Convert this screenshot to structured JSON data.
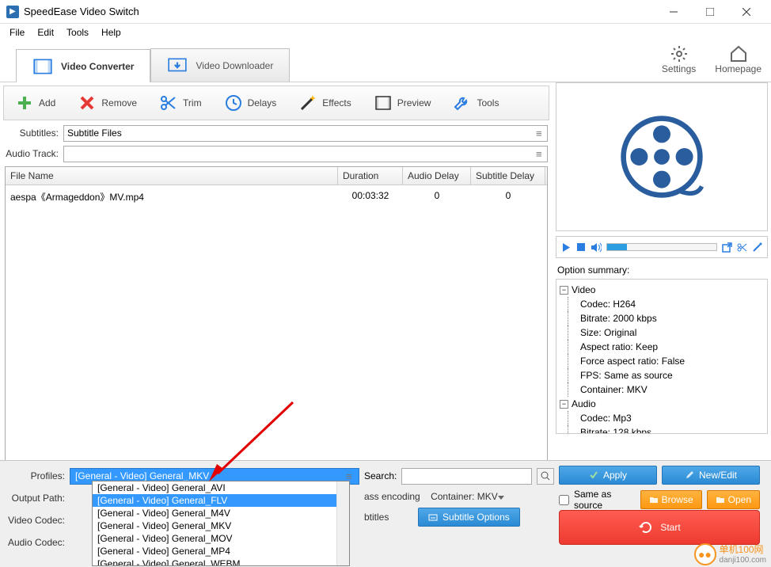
{
  "window": {
    "title": "SpeedEase Video Switch"
  },
  "menu": [
    "File",
    "Edit",
    "Tools",
    "Help"
  ],
  "tabs": [
    {
      "label": "Video Converter",
      "active": true
    },
    {
      "label": "Video Downloader",
      "active": false
    }
  ],
  "header_icons": {
    "settings": "Settings",
    "homepage": "Homepage"
  },
  "toolbar": {
    "add": "Add",
    "remove": "Remove",
    "trim": "Trim",
    "delays": "Delays",
    "effects": "Effects",
    "preview": "Preview",
    "tools": "Tools"
  },
  "fields": {
    "subtitles_label": "Subtitles:",
    "subtitles_value": "Subtitle Files",
    "audiotrack_label": "Audio Track:",
    "audiotrack_value": ""
  },
  "table": {
    "headers": [
      "File Name",
      "Duration",
      "Audio Delay",
      "Subtitle Delay"
    ],
    "rows": [
      {
        "filename": "aespa《Armageddon》MV.mp4",
        "duration": "00:03:32",
        "audio_delay": "0",
        "subtitle_delay": "0"
      }
    ]
  },
  "option_summary": {
    "title": "Option summary:",
    "video": {
      "label": "Video",
      "codec": "Codec: H264",
      "bitrate": "Bitrate: 2000 kbps",
      "size": "Size:  Original",
      "aspect": "Aspect ratio: Keep",
      "force_aspect": "Force aspect ratio: False",
      "fps": "FPS: Same as source",
      "container": "Container: MKV"
    },
    "audio": {
      "label": "Audio",
      "codec": "Codec: Mp3",
      "bitrate": "Bitrate: 128 kbps"
    }
  },
  "bottom": {
    "profiles_label": "Profiles:",
    "profiles_value": "[General - Video] General_MKV",
    "outputpath_label": "Output Path:",
    "videocodec_label": "Video Codec:",
    "audiocodec_label": "Audio Codec:",
    "search_label": "Search:",
    "twopass_text": "ass encoding",
    "subtitles_text": "btitles",
    "container_label": "Container:",
    "container_value": "MKV",
    "subtitle_options": "Subtitle Options",
    "apply": "Apply",
    "newedit": "New/Edit",
    "same_as_source": "Same as source",
    "browse": "Browse",
    "open": "Open",
    "start": "Start"
  },
  "dropdown": {
    "options": [
      "[General - Video] General_AVI",
      "[General - Video] General_FLV",
      "[General - Video] General_M4V",
      "[General - Video] General_MKV",
      "[General - Video] General_MOV",
      "[General - Video] General_MP4",
      "[General - Video] General_WEBM"
    ],
    "hover_index": 1
  },
  "watermark": {
    "brand": "单机100网",
    "url": "danji100.com"
  }
}
